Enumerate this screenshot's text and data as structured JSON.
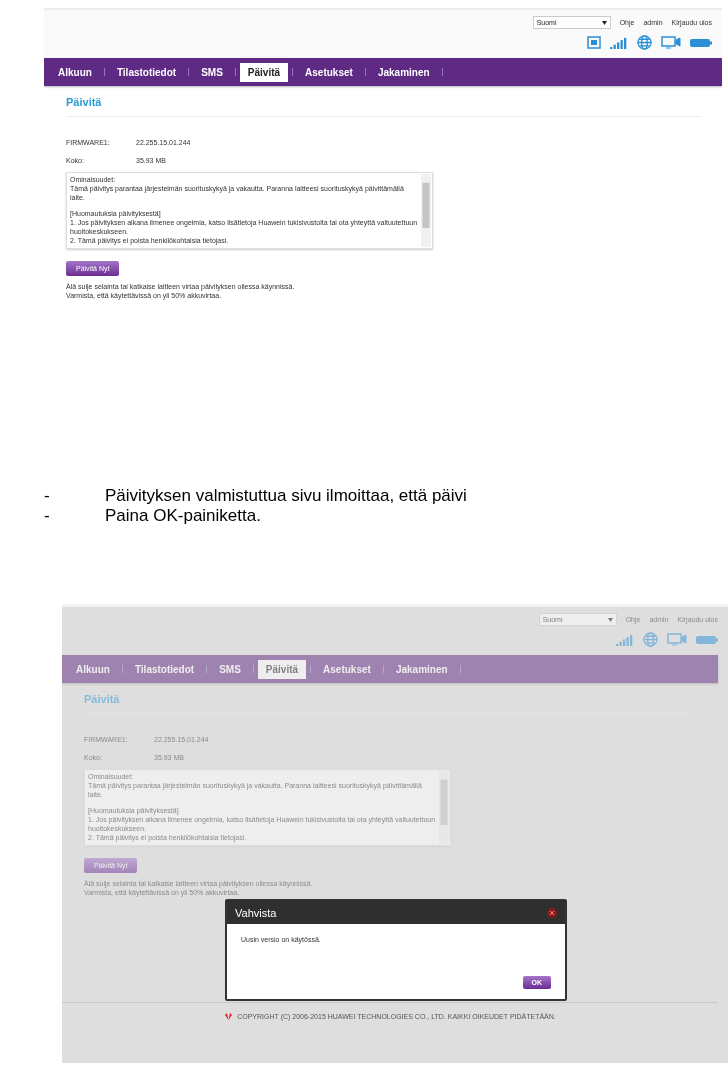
{
  "screenshots": [
    {
      "dimmed": false,
      "language": "Suomi",
      "top_links": [
        "Ohje",
        "admin",
        "Kirjaudu ulos"
      ],
      "status_icons": [
        {
          "kind": "message"
        },
        {
          "kind": "signal"
        },
        {
          "kind": "globe"
        },
        {
          "kind": "monitor"
        },
        {
          "kind": "battery"
        }
      ],
      "nav": [
        {
          "label": "Alkuun",
          "selected": false
        },
        {
          "label": "Tilastotiedot",
          "selected": false
        },
        {
          "label": "SMS",
          "selected": false
        },
        {
          "label": "Päivitä",
          "selected": true
        },
        {
          "label": "Asetukset",
          "selected": false
        },
        {
          "label": "Jakaminen",
          "selected": false
        }
      ],
      "heading": "Päivitä",
      "fields": [
        {
          "label": "FIRMWARE1:",
          "value": "22.255.15.01.244"
        },
        {
          "label": "Koko:",
          "value": "35.93 MB"
        }
      ],
      "release_notes": [
        {
          "lines": [
            "Ominaisuudet:",
            "Tämä päivitys parantaa järjestelmän suorituskykyä ja vakautta. Paranna laitteesi suorituskykyä päivittämällä laite."
          ]
        },
        {
          "lines": [
            "[Huomautuksia päivityksestä]",
            "1. Jos päivityksen aikana ilmenee ongelmia, katso lisätietoja Huawein tukisivustolta tai ota yhteyttä valtuutettuun huoltokeskukseen.",
            "2. Tämä päivitys ei poista henkilökohtaisia tietojasi."
          ]
        }
      ],
      "button": "Päivitä Nyt",
      "notes": [
        "Älä sulje selainta tai katkaise laitteen virtaa päivityksen ollessa käynnissä.",
        "Varmista, että käytettävissä on yli 50% akkuvirtaa."
      ]
    },
    {
      "dimmed": true,
      "language": "Suomi",
      "top_links": [
        "Ohje",
        "admin",
        "Kirjaudu ulos"
      ],
      "status_icons": [
        {
          "kind": "signal"
        },
        {
          "kind": "globe"
        },
        {
          "kind": "monitor"
        },
        {
          "kind": "battery"
        }
      ],
      "nav": [
        {
          "label": "Alkuun",
          "selected": false
        },
        {
          "label": "Tilastotiedot",
          "selected": false
        },
        {
          "label": "SMS",
          "selected": false
        },
        {
          "label": "Päivitä",
          "selected": true
        },
        {
          "label": "Asetukset",
          "selected": false
        },
        {
          "label": "Jakaminen",
          "selected": false
        }
      ],
      "heading": "Päivitä",
      "fields": [
        {
          "label": "FIRMWARE1:",
          "value": "22.255.15.01.244"
        },
        {
          "label": "Koko:",
          "value": "35.93 MB"
        }
      ],
      "release_notes": [
        {
          "lines": [
            "Ominaisuudet:",
            "Tämä päivitys parantaa järjestelmän suorituskykyä ja vakautta. Paranna laitteesi suorituskykyä päivittämällä laite."
          ]
        },
        {
          "lines": [
            "[Huomautuksia päivityksestä]",
            "1. Jos päivityksen aikana ilmenee ongelmia, katso lisätietoja Huawein tukisivustolta tai ota yhteyttä valtuutettuun huoltokeskukseen.",
            "2. Tämä päivitys ei poista henkilökohtaisia tietojasi."
          ]
        }
      ],
      "button": "Päivitä Nyt",
      "notes": [
        "Älä sulje selainta tai katkaise laitteen virtaa päivityksen ollessa käynnissä.",
        "Varmista, että käytettävissä on yli 50% akkuvirtaa."
      ],
      "dialog": {
        "title": "Vahvista",
        "message": "Uusin versio on käytössä.",
        "button": "OK"
      },
      "footer": "COPYRIGHT (C) 2006-2015 HUAWEI TECHNOLOGIES CO., LTD. KAIKKI OIKEUDET PIDÄTETÄÄN."
    }
  ],
  "instructions": [
    {
      "marker": "-",
      "text": "Päivityksen valmistuttua sivu ilmoittaa, että päivi"
    },
    {
      "marker": "-",
      "text": "Paina OK-painiketta."
    }
  ]
}
